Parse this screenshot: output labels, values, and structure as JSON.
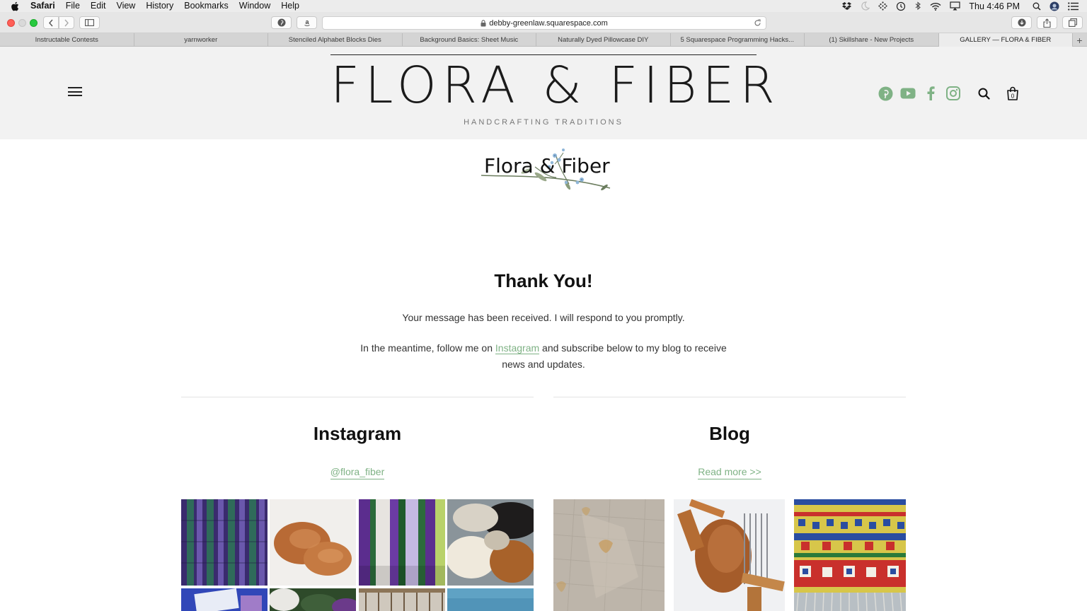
{
  "menubar": {
    "app": "Safari",
    "items": [
      "File",
      "Edit",
      "View",
      "History",
      "Bookmarks",
      "Window",
      "Help"
    ],
    "clock": "Thu 4:46 PM"
  },
  "toolbar": {
    "url": "debby-greenlaw.squarespace.com"
  },
  "tabs": [
    {
      "label": "Instructable Contests"
    },
    {
      "label": "yarnworker"
    },
    {
      "label": "Stenciled Alphabet Blocks Dies"
    },
    {
      "label": "Background Basics: Sheet Music"
    },
    {
      "label": "Naturally Dyed Pillowcase DIY"
    },
    {
      "label": "5 Squarespace Programming Hacks..."
    },
    {
      "label": "(1) Skillshare - New Projects"
    },
    {
      "label": "GALLERY — FLORA & FIBER"
    }
  ],
  "site": {
    "title": "FLORA & FIBER",
    "tagline": "HANDCRAFTING TRADITIONS",
    "cart_count": "0",
    "social_icons": [
      "pinterest-icon",
      "youtube-icon",
      "facebook-icon",
      "instagram-icon"
    ],
    "accent_color": "#7fb285"
  },
  "logo": {
    "text": "Flora & Fiber"
  },
  "main": {
    "heading": "Thank You!",
    "message": "Your message has been received. I will respond to you promptly.",
    "follow_before": "In the meantime, follow me on ",
    "follow_link": "Instagram",
    "follow_after": " and subscribe below to my blog to receive news and updates."
  },
  "instagram": {
    "title": "Instagram",
    "handle": "@flora_fiber"
  },
  "blog": {
    "title": "Blog",
    "read_more": "Read more >>"
  }
}
